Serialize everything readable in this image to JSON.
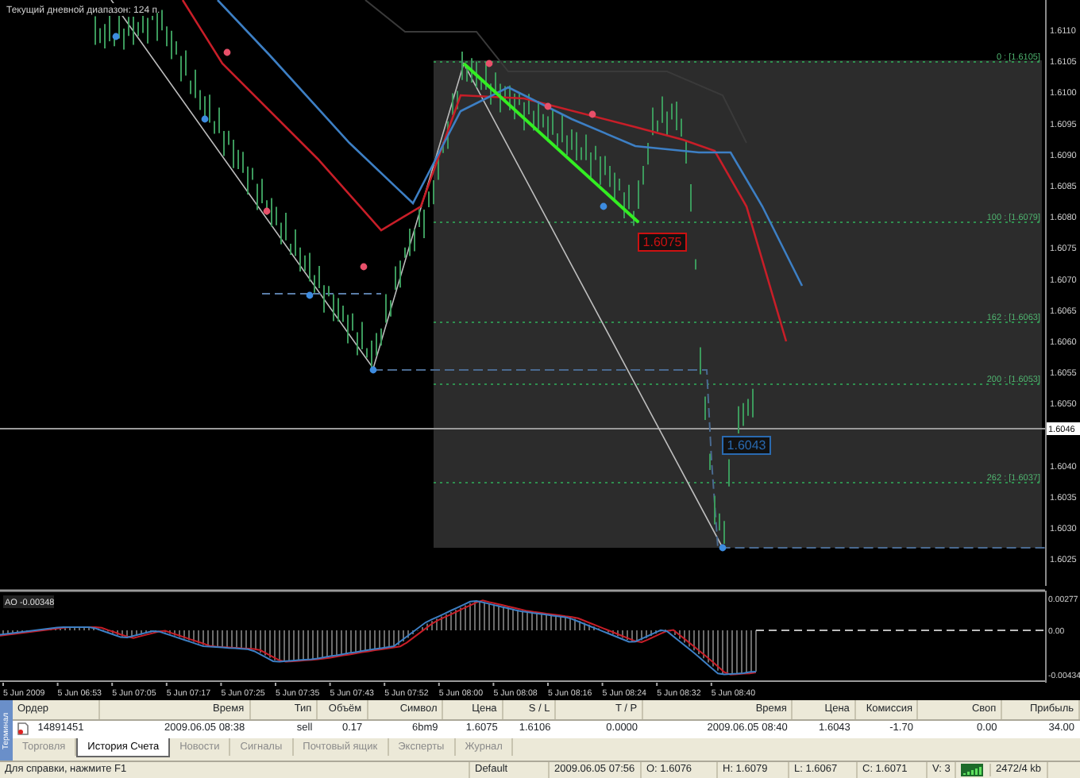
{
  "chart": {
    "title": "Текущий дневной диапазон: 124 п.",
    "price_scale": [
      {
        "text": "1.6110",
        "kind": "tick"
      },
      {
        "text": "1.6105",
        "kind": "tick"
      },
      {
        "text": "1.6100",
        "kind": "tick"
      },
      {
        "text": "1.6095",
        "kind": "tick"
      },
      {
        "text": "1.6090",
        "kind": "tick"
      },
      {
        "text": "1.6085",
        "kind": "tick"
      },
      {
        "text": "1.6080",
        "kind": "tick"
      },
      {
        "text": "1.6075",
        "kind": "tick"
      },
      {
        "text": "1.6070",
        "kind": "tick"
      },
      {
        "text": "1.6065",
        "kind": "tick"
      },
      {
        "text": "1.6060",
        "kind": "tick"
      },
      {
        "text": "1.6055",
        "kind": "tick"
      },
      {
        "text": "1.6050",
        "kind": "tick"
      },
      {
        "text": "1.6046",
        "kind": "current"
      },
      {
        "text": "1.6040",
        "kind": "tick"
      },
      {
        "text": "1.6035",
        "kind": "tick"
      },
      {
        "text": "1.6030",
        "kind": "tick"
      },
      {
        "text": "1.6025",
        "kind": "tick"
      }
    ],
    "fib_levels": [
      "0 : [1.6105]",
      "100 : [1.6079]",
      "162 : [1.6063]",
      "200 : [1.6053]",
      "262 : [1.6037]"
    ],
    "trade_labels": [
      {
        "text": "1.6075",
        "color": "#cc1111"
      },
      {
        "text": "1.6043",
        "color": "#2a6ab0"
      }
    ]
  },
  "indicator": {
    "label": "AO -0.00348",
    "scale": [
      "0.00277",
      "0.00",
      "-0.00434"
    ]
  },
  "time_axis": [
    "5 Jun 2009",
    "5 Jun 06:53",
    "5 Jun 07:05",
    "5 Jun 07:17",
    "5 Jun 07:25",
    "5 Jun 07:35",
    "5 Jun 07:43",
    "5 Jun 07:52",
    "5 Jun 08:00",
    "5 Jun 08:08",
    "5 Jun 08:16",
    "5 Jun 08:24",
    "5 Jun 08:32",
    "5 Jun 08:40"
  ],
  "terminal": {
    "side_tab": "Терминал",
    "columns": [
      "Ордер",
      "Время",
      "Тип",
      "Объём",
      "Символ",
      "Цена",
      "S / L",
      "T / P",
      "Время",
      "Цена",
      "Комиссия",
      "Своп",
      "Прибыль"
    ],
    "rows": [
      [
        "14891451",
        "2009.06.05 08:38",
        "sell",
        "0.17",
        "6bm9",
        "1.6075",
        "1.6106",
        "0.0000",
        "2009.06.05 08:40",
        "1.6043",
        "-1.70",
        "0.00",
        "34.00"
      ]
    ],
    "tabs": [
      {
        "label": "Торговля",
        "selected": false
      },
      {
        "label": "История Счета",
        "selected": true
      },
      {
        "label": "Новости",
        "selected": false
      },
      {
        "label": "Сигналы",
        "selected": false
      },
      {
        "label": "Почтовый ящик",
        "selected": false
      },
      {
        "label": "Эксперты",
        "selected": false
      },
      {
        "label": "Журнал",
        "selected": false
      }
    ]
  },
  "status_bar": [
    {
      "kind": "text",
      "text": "Для справки, нажмите F1"
    },
    {
      "kind": "text",
      "text": "Default"
    },
    {
      "kind": "text",
      "text": "2009.06.05 07:56"
    },
    {
      "kind": "text",
      "text": "O: 1.6076"
    },
    {
      "kind": "text",
      "text": "H: 1.6079"
    },
    {
      "kind": "text",
      "text": "L: 1.6067"
    },
    {
      "kind": "text",
      "text": "C: 1.6071"
    },
    {
      "kind": "text",
      "text": "V: 3"
    },
    {
      "kind": "connection"
    },
    {
      "kind": "text",
      "text": "2472/4 kb"
    }
  ]
}
